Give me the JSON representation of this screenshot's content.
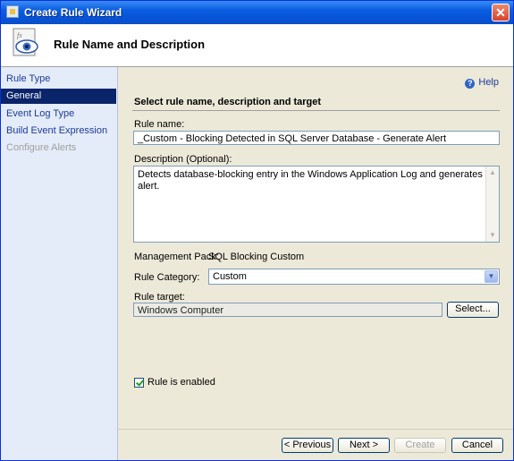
{
  "window": {
    "title": "Create Rule Wizard",
    "close_glyph": "✕"
  },
  "header": {
    "title": "Rule Name and Description",
    "icon": "wizard-eye-icon"
  },
  "nav": {
    "items": [
      {
        "label": "Rule Type",
        "state": "normal"
      },
      {
        "label": "General",
        "state": "selected"
      },
      {
        "label": "Event Log Type",
        "state": "normal"
      },
      {
        "label": "Build Event Expression",
        "state": "normal"
      },
      {
        "label": "Configure Alerts",
        "state": "disabled"
      }
    ]
  },
  "help": {
    "label": "Help",
    "icon": "help-icon"
  },
  "section_title": "Select rule name, description and target",
  "form": {
    "rule_name_label": "Rule name:",
    "rule_name_value": "_Custom - Blocking Detected in SQL Server Database - Generate Alert",
    "description_label": "Description (Optional):",
    "description_value": "Detects database-blocking entry in the Windows Application Log and generates alert.",
    "management_pack_label": "Management Pack:",
    "management_pack_value": "SQL Blocking Custom",
    "rule_category_label": "Rule Category:",
    "rule_category_value": "Custom",
    "rule_target_label": "Rule target:",
    "rule_target_value": "Windows Computer",
    "select_button": "Select...",
    "enabled_label": "Rule is enabled",
    "enabled_checked": true
  },
  "buttons": {
    "previous": "< Previous",
    "next": "Next >",
    "create": "Create",
    "cancel": "Cancel"
  }
}
